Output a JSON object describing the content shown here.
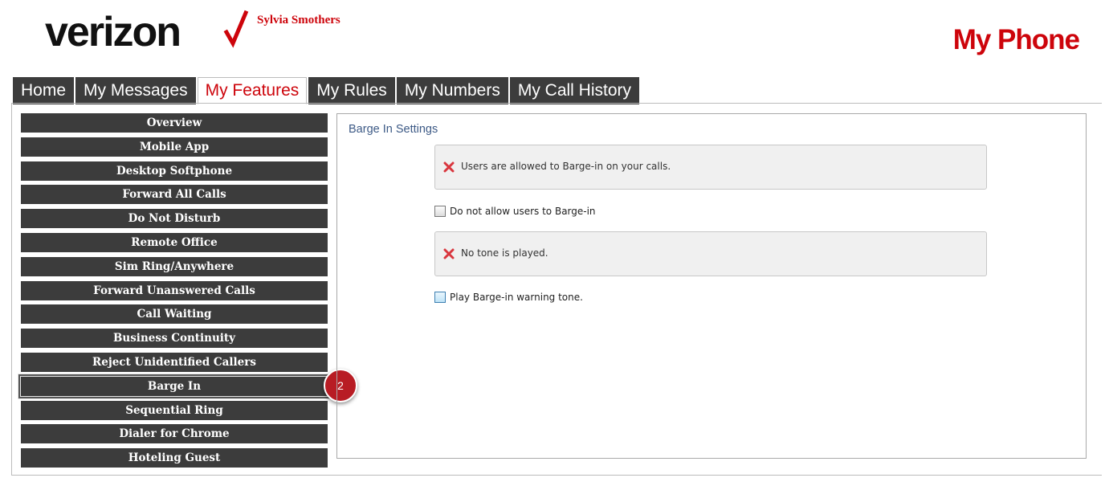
{
  "header": {
    "brand": "verizon",
    "user_name": "Sylvia Smothers",
    "app_title": "My Phone",
    "accent_color": "#cd040b"
  },
  "tabs": [
    {
      "label": "Home",
      "active": false
    },
    {
      "label": "My Messages",
      "active": false
    },
    {
      "label": "My Features",
      "active": true
    },
    {
      "label": "My Rules",
      "active": false
    },
    {
      "label": "My Numbers",
      "active": false
    },
    {
      "label": "My Call History",
      "active": false
    }
  ],
  "sidebar": {
    "items": [
      {
        "label": "Overview"
      },
      {
        "label": "Mobile App"
      },
      {
        "label": "Desktop Softphone"
      },
      {
        "label": "Forward All Calls"
      },
      {
        "label": "Do Not Disturb"
      },
      {
        "label": "Remote Office"
      },
      {
        "label": "Sim Ring/Anywhere"
      },
      {
        "label": "Forward Unanswered Calls"
      },
      {
        "label": "Call Waiting"
      },
      {
        "label": "Business Continuity"
      },
      {
        "label": "Reject Unidentified Callers"
      },
      {
        "label": "Barge In"
      },
      {
        "label": "Sequential Ring"
      },
      {
        "label": "Dialer for Chrome"
      },
      {
        "label": "Hoteling Guest"
      }
    ],
    "selected": "Barge In",
    "step_badge": "2"
  },
  "main": {
    "title": "Barge In Settings",
    "status_1": {
      "icon": "x-icon",
      "text": "Users are allowed to Barge-in on your calls."
    },
    "option_1": {
      "label": "Do not allow users to Barge-in",
      "checked": false
    },
    "status_2": {
      "icon": "x-icon",
      "text": "No tone is played."
    },
    "option_2": {
      "label": "Play Barge-in warning tone.",
      "checked": false
    }
  }
}
